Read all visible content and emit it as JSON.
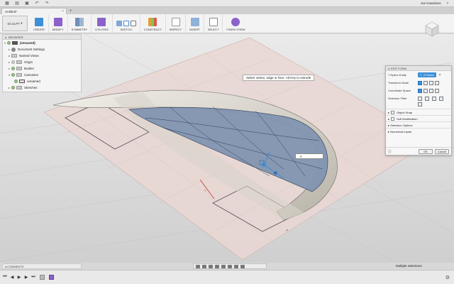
{
  "window": {
    "user_name": "Joe Kawahara"
  },
  "tabs": [
    {
      "label": "Untitled*"
    }
  ],
  "toolbar": {
    "workspace": "SCULPT",
    "groups": [
      {
        "label": "CREATE"
      },
      {
        "label": "MODIFY"
      },
      {
        "label": "SYMMETRY"
      },
      {
        "label": "UTILITIES"
      },
      {
        "label": "SKETCH"
      },
      {
        "label": "CONSTRUCT"
      },
      {
        "label": "INSPECT"
      },
      {
        "label": "INSERT"
      },
      {
        "label": "SELECT"
      },
      {
        "label": "FINISH FORM"
      }
    ]
  },
  "browser": {
    "title": "BROWSER",
    "items": [
      {
        "label": "(Unsaved)"
      },
      {
        "label": "Document Settings"
      },
      {
        "label": "Named Views"
      },
      {
        "label": "Origin"
      },
      {
        "label": "Bodies"
      },
      {
        "label": "Canvases"
      },
      {
        "label": "unnamed"
      },
      {
        "label": "Sketches"
      }
    ]
  },
  "viewport": {
    "tooltip": "Select vertex, edge or face. Alt Key to extrude",
    "distance_value": "4"
  },
  "edit_form": {
    "title": "EDIT FORM",
    "tspline_entity_label": "T-Spline Entity",
    "tspline_entity_value": "8 Faces",
    "transform_mode_label": "Transform Mode",
    "coordinate_space_label": "Coordinate Space",
    "selection_filter_label": "Selection Filter",
    "object_snap_label": "Object Snap",
    "soft_modification_label": "Soft Modification",
    "selection_options_label": "Selection Options",
    "numerical_inputs_label": "Numerical Inputs",
    "ok_label": "OK",
    "cancel_label": "Cancel"
  },
  "comments": {
    "title": "COMMENTS"
  },
  "status": {
    "text": "Multiple selections"
  },
  "colors": {
    "accent": "#3d8fd8",
    "surface_blue": "#7f93b0",
    "canvas_tint": "#e8d9d6",
    "timeline_item": "#8a62c9"
  }
}
